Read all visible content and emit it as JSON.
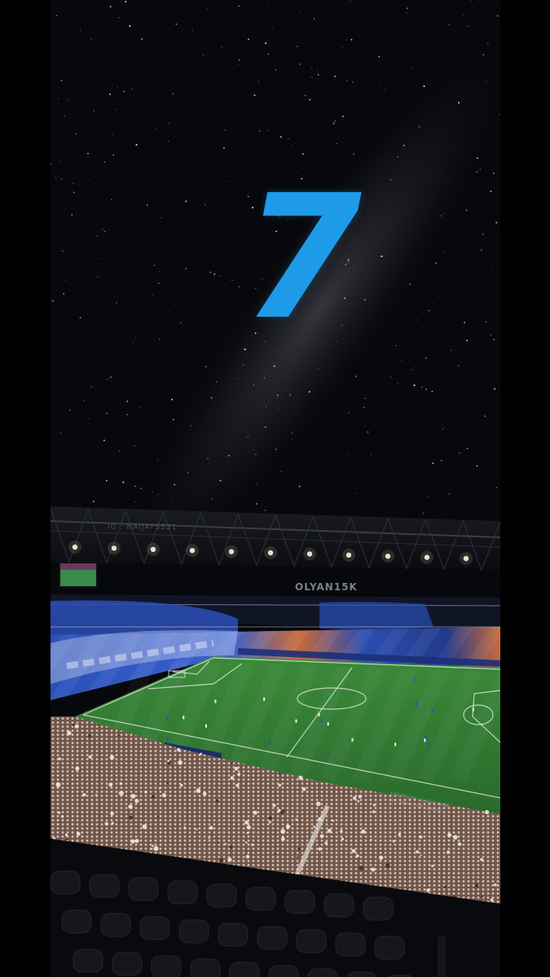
{
  "story": {
    "number": "7",
    "number_color": "#1e9be8"
  },
  "watermarks": {
    "ig_handle": "IG : NAIJAFSS21",
    "main": "OLYAN15K"
  },
  "ad_boards": {
    "line1": "CHAMPIONS LEAGUE ELITE",
    "line2": "AFC ASIAN CUP LEAGUE"
  },
  "scene": {
    "sky_color": "#07080b",
    "pitch_color": "#2f7a32",
    "home_fans_color": "#2a4fb8",
    "away_fans_color": "#c86a3a",
    "crowd_color": "#e8e6e3",
    "scoreboard_color": "#3a8a4a"
  }
}
